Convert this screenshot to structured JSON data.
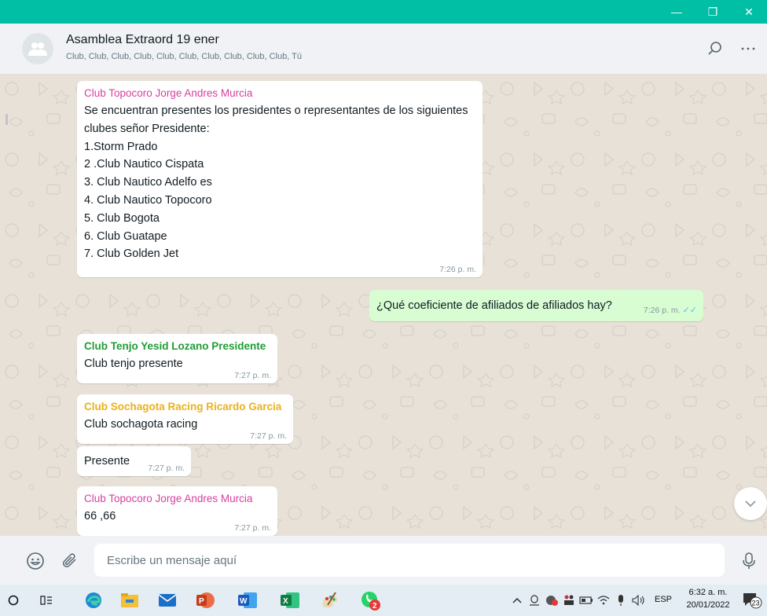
{
  "window": {
    "minimize_glyph": "—",
    "restore_glyph": "❐",
    "close_glyph": "✕"
  },
  "chat": {
    "name": "Asamblea Extraord 19 ener",
    "members": "Club, Club, Club, Club, Club, Club, Club, Club, Club, Club, Tú"
  },
  "messages": [
    {
      "sender": "Club Topocoro Jorge Andres Murcia",
      "sender_color": "#d6409f",
      "text": "Se encuentran presentes los presidentes o representantes de los siguientes clubes señor Presidente:\n1.Storm Prado\n2 .Club Nautico Cispata\n3. Club Nautico Adelfo es\n4. Club Nautico Topocoro\n5. Club Bogota\n6. Club Guatape\n7. Club Golden Jet",
      "time": "7:26 p. m."
    },
    {
      "text": "¿Qué coeficiente de afiliados de afiliados hay?",
      "time": "7:26 p. m.",
      "status": "read",
      "status_glyph": "✓✓"
    },
    {
      "sender": "Club Tenjo Yesid Lozano Presidente",
      "sender_color": "#1f9c35",
      "text": "Club tenjo presente",
      "time": "7:27 p. m."
    },
    {
      "sender": "Club Sochagota Racing Ricardo Garcia",
      "sender_color": "#e9b21b",
      "text": "Club sochagota racing",
      "time": "7:27 p. m."
    },
    {
      "text": "Presente",
      "time": "7:27 p. m."
    },
    {
      "sender": "Club Topocoro Jorge Andres Murcia",
      "sender_color": "#d6409f",
      "text": "66 ,66",
      "time": "7:27 p. m."
    }
  ],
  "composer": {
    "placeholder": "Escribe un mensaje aquí"
  },
  "taskbar": {
    "badge_whatsapp": "2",
    "language": "ESP",
    "time": "6:32 a. m.",
    "date": "20/01/2022",
    "notifications": "23"
  },
  "colors": {
    "accent": "#00bfa5",
    "outgoing": "#d9fdd3"
  }
}
